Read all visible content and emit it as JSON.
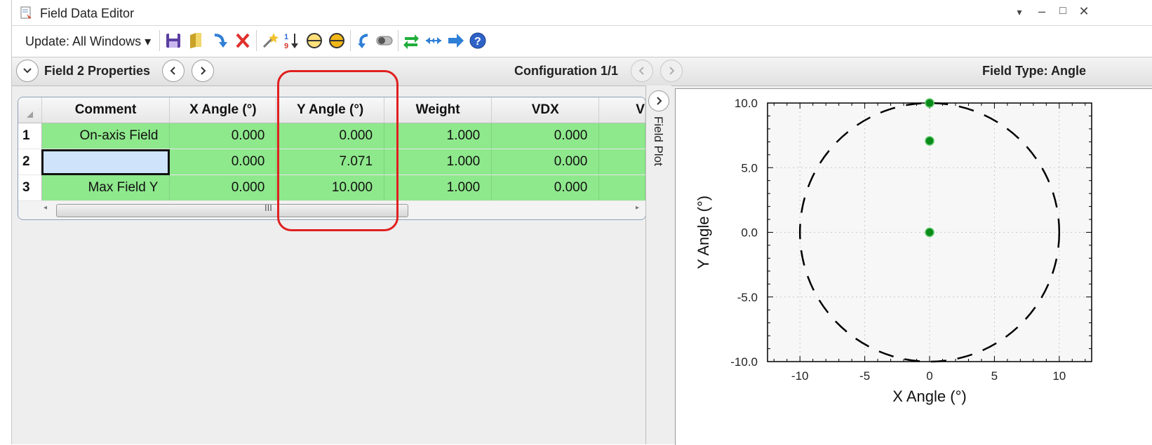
{
  "window": {
    "title": "Field Data Editor",
    "controls": [
      "▾",
      "–",
      "□",
      "✕"
    ]
  },
  "toolbar": {
    "update_label": "Update: All Windows ▾",
    "icons": [
      "save-icon",
      "open-icon",
      "insert-icon",
      "delete-icon",
      "wizard-icon",
      "sort-icon",
      "circle-icon",
      "ellipse-icon",
      "undo-icon",
      "toggle-icon",
      "swap-icon",
      "double-arrow-icon",
      "arrow-right-icon",
      "help-icon"
    ]
  },
  "propbar": {
    "field_props": "Field  2 Properties",
    "configuration": "Configuration 1/1",
    "field_type": "Field Type: Angle"
  },
  "table": {
    "columns": [
      "Comment",
      "X Angle (°)",
      "Y Angle (°)",
      "Weight",
      "VDX",
      "V"
    ],
    "rows": [
      {
        "num": "1",
        "comment": "On-axis Field",
        "x": "0.000",
        "y": "0.000",
        "weight": "1.000",
        "vdx": "0.000"
      },
      {
        "num": "2",
        "comment": "",
        "x": "0.000",
        "y": "7.071",
        "weight": "1.000",
        "vdx": "0.000"
      },
      {
        "num": "3",
        "comment": "Max Field Y",
        "x": "0.000",
        "y": "10.000",
        "weight": "1.000",
        "vdx": "0.000"
      }
    ],
    "scroll_grip": "III"
  },
  "side_panel": {
    "label": "Field Plot"
  },
  "chart_data": {
    "type": "scatter",
    "xlabel": "X Angle (°)",
    "ylabel": "Y Angle (°)",
    "xlim": [
      -12.5,
      12.5
    ],
    "ylim": [
      -10,
      10
    ],
    "xticks": [
      "-10",
      "-5",
      "0",
      "5",
      "10"
    ],
    "yticks": [
      "10.0",
      "5.0",
      "0.0",
      "-5.0",
      "-10.0"
    ],
    "points": [
      {
        "x": 0,
        "y": 0
      },
      {
        "x": 0,
        "y": 7.071
      },
      {
        "x": 0,
        "y": 10
      }
    ],
    "boundary_circle_radius": 10,
    "grid": true,
    "colors": {
      "points": "#0a8a1a",
      "circle": "#000000"
    }
  }
}
